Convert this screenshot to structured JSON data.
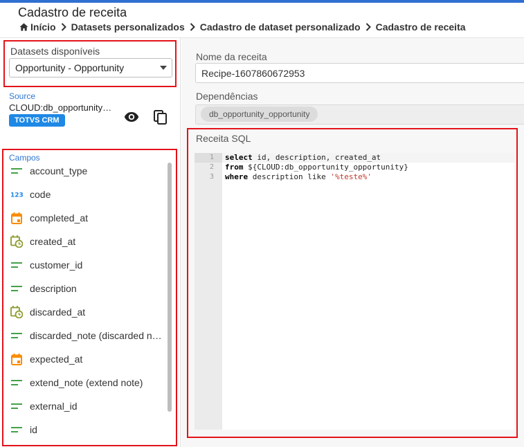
{
  "header": {
    "title": "Cadastro de receita",
    "breadcrumb": [
      "Início",
      "Datasets personalizados",
      "Cadastro de dataset personalizado",
      "Cadastro de receita"
    ]
  },
  "left": {
    "datasets_label": "Datasets disponíveis",
    "datasets_selected": "Opportunity - Opportunity",
    "source_label": "Source",
    "source_name": "CLOUD:db_opportunity_opportunity",
    "source_tag": "TOTVS CRM",
    "fields_label": "Campos",
    "fields": [
      {
        "name": "account_type",
        "icon": "text-icon"
      },
      {
        "name": "code",
        "icon": "number-icon"
      },
      {
        "name": "completed_at",
        "icon": "date-icon"
      },
      {
        "name": "created_at",
        "icon": "datetime-icon"
      },
      {
        "name": "customer_id",
        "icon": "text-icon"
      },
      {
        "name": "description",
        "icon": "text-icon"
      },
      {
        "name": "discarded_at",
        "icon": "datetime-icon"
      },
      {
        "name": "discarded_note (discarded note)",
        "icon": "text-icon"
      },
      {
        "name": "expected_at",
        "icon": "date-icon"
      },
      {
        "name": "extend_note (extend note)",
        "icon": "text-icon"
      },
      {
        "name": "external_id",
        "icon": "text-icon"
      },
      {
        "name": "id",
        "icon": "text-icon"
      }
    ]
  },
  "right": {
    "recipe_name_label": "Nome da receita",
    "recipe_name_value": "Recipe-1607860672953",
    "dependencies_label": "Dependências",
    "dependency_chip": "db_opportunity_opportunity",
    "sql_label": "Receita SQL",
    "sql_lines": [
      {
        "no": "1",
        "kw": "select",
        "rest": " id, description, created_at",
        "str": ""
      },
      {
        "no": "2",
        "kw": "from",
        "rest": " ${CLOUD:db_opportunity_opportunity}",
        "str": ""
      },
      {
        "no": "3",
        "kw": "where",
        "rest": " description like ",
        "str": "'%teste%'"
      }
    ]
  },
  "colors": {
    "accent": "#2f6fd1",
    "highlight": "#e3121a",
    "text_icon": "#43a047",
    "number_icon": "#1e88e5",
    "date_icon": "#fb8c00",
    "datetime_icon": "#8d9b2e"
  }
}
